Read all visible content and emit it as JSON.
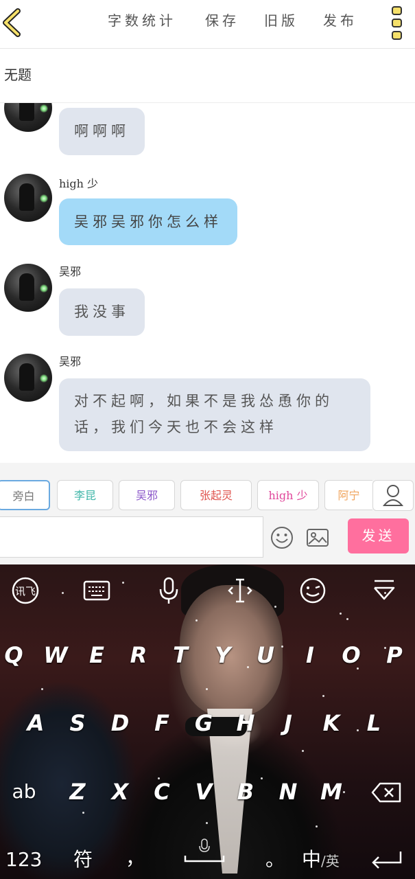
{
  "header": {
    "back_icon": "chevron-left-icon",
    "actions": [
      "字数统计",
      "保存",
      "旧版",
      "发布"
    ],
    "menu_icon": "more-dots-icon",
    "title": "无题"
  },
  "chat": {
    "messages": [
      {
        "name": "",
        "text": "啊啊啊",
        "style": "gray"
      },
      {
        "name": "high 少",
        "text": "吴邪吴邪你怎么样",
        "style": "blue"
      },
      {
        "name": "吴邪",
        "text": "我没事",
        "style": "gray"
      },
      {
        "name": "吴邪",
        "text_line1": "对不起啊，如果不是我怂恿你的",
        "text_line2": "话，我们今天也不会这样",
        "style": "gray"
      }
    ]
  },
  "speakers": {
    "chips": [
      {
        "label": "旁白",
        "color": "#777777"
      },
      {
        "label": "李昆",
        "color": "#3fb6a8"
      },
      {
        "label": "吴邪",
        "color": "#8a55c9"
      },
      {
        "label": "张起灵",
        "color": "#e0554f"
      },
      {
        "label": "high 少",
        "color": "#e0469a"
      },
      {
        "label": "阿宁",
        "color": "#f0a35a"
      }
    ],
    "user_icon": "user-icon"
  },
  "composer": {
    "input_value": "",
    "emoji_icon": "smiley-icon",
    "image_icon": "image-icon",
    "send_label": "发送",
    "send_color": "#ff6f9e"
  },
  "keyboard": {
    "toolbar": [
      "ifly-logo-icon",
      "keyboard-icon",
      "microphone-icon",
      "cursor-icon",
      "emoji-face-icon",
      "collapse-icon"
    ],
    "row1": [
      "Q",
      "W",
      "E",
      "R",
      "T",
      "Y",
      "U",
      "I",
      "O",
      "P"
    ],
    "row2": [
      "A",
      "S",
      "D",
      "F",
      "G",
      "H",
      "J",
      "K",
      "L"
    ],
    "row3": [
      "ab",
      "Z",
      "X",
      "C",
      "V",
      "B",
      "N",
      "M"
    ],
    "backspace_icon": "backspace-icon",
    "row4": {
      "num": "123",
      "sym": "符",
      "comma": "，",
      "space_icon": "space-mic-icon",
      "period": "。",
      "lang_main": "中",
      "lang_sub": "/英",
      "enter_icon": "enter-icon"
    }
  }
}
